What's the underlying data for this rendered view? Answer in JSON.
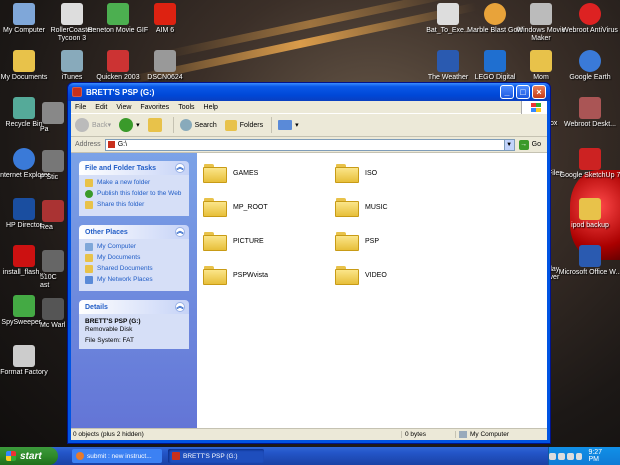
{
  "desktop": {
    "icons": [
      {
        "label": "My Computer"
      },
      {
        "label": "RollerCoaster Tycoon 3"
      },
      {
        "label": "Beneton Movie GIF"
      },
      {
        "label": "AIM 6"
      },
      {
        "label": "My Documents"
      },
      {
        "label": "iTunes"
      },
      {
        "label": "Quicken 2003"
      },
      {
        "label": "DSCN0624"
      },
      {
        "label": "Recycle Bin"
      },
      {
        "label": "Internet Explorer"
      },
      {
        "label": "HP Director"
      },
      {
        "label": "install_flash..."
      },
      {
        "label": "SpySweeper..."
      },
      {
        "label": "Format Factory"
      },
      {
        "label": "Bat_To_Exe..."
      },
      {
        "label": "Marble Blast Gold"
      },
      {
        "label": "Windows Movie Maker"
      },
      {
        "label": "Webroot AntiVirus"
      },
      {
        "label": "The Weather"
      },
      {
        "label": "LEGO Digital"
      },
      {
        "label": "Mom"
      },
      {
        "label": "Google Earth"
      },
      {
        "label": "Webroot Deskt..."
      },
      {
        "label": "Google SketchUp 7"
      },
      {
        "label": "ipod backup"
      },
      {
        "label": "Microsoft Office W..."
      }
    ],
    "partial_labels": [
      "Pa",
      "P Stic",
      "Rea",
      "510C ast",
      "Mc Warl",
      "fox",
      "Files",
      "day iver"
    ]
  },
  "window": {
    "title": "BRETT'S PSP (G:)",
    "menu": [
      "File",
      "Edit",
      "View",
      "Favorites",
      "Tools",
      "Help"
    ],
    "toolbar": {
      "back": "Back",
      "search": "Search",
      "folders": "Folders"
    },
    "address": {
      "label": "Address",
      "value": "G:\\",
      "go": "Go"
    },
    "taskpane": {
      "file_tasks": {
        "title": "File and Folder Tasks",
        "items": [
          "Make a new folder",
          "Publish this folder to the Web",
          "Share this folder"
        ]
      },
      "other_places": {
        "title": "Other Places",
        "items": [
          "My Computer",
          "My Documents",
          "Shared Documents",
          "My Network Places"
        ]
      },
      "details": {
        "title": "Details",
        "name": "BRETT'S PSP (G:)",
        "type": "Removable Disk",
        "fs": "File System: FAT"
      }
    },
    "folders": [
      "GAMES",
      "ISO",
      "MP_ROOT",
      "MUSIC",
      "PICTURE",
      "PSP",
      "PSPWvista",
      "VIDEO"
    ],
    "status": {
      "objects": "0 objects (plus 2 hidden)",
      "size": "0 bytes",
      "location": "My Computer"
    }
  },
  "taskbar": {
    "start": "start",
    "tasks": [
      {
        "label": "submit : new instruct..."
      },
      {
        "label": "BRETT'S PSP (G:)"
      }
    ],
    "clock": "9:27 PM"
  }
}
